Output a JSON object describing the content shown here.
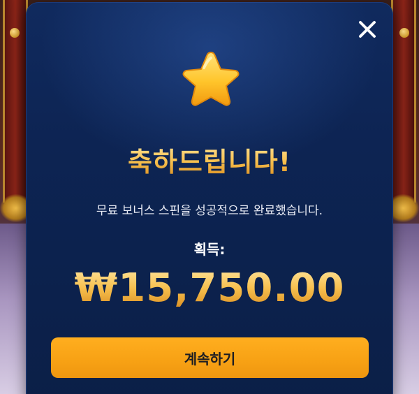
{
  "modal": {
    "close_icon": "close-icon",
    "star_icon": "star-icon",
    "title": "축하드립니다!",
    "subtitle": "무료 보너스 스핀을 성공적으로 완료했습니다.",
    "earned_label": "획득:",
    "amount": "₩15,750.00",
    "continue_label": "계속하기"
  },
  "colors": {
    "modal_bg": "#0d2453",
    "gold": "#f6c25a",
    "button": "#f7a114",
    "button_text": "#1d1d22",
    "text_light": "#e9ecf5"
  }
}
